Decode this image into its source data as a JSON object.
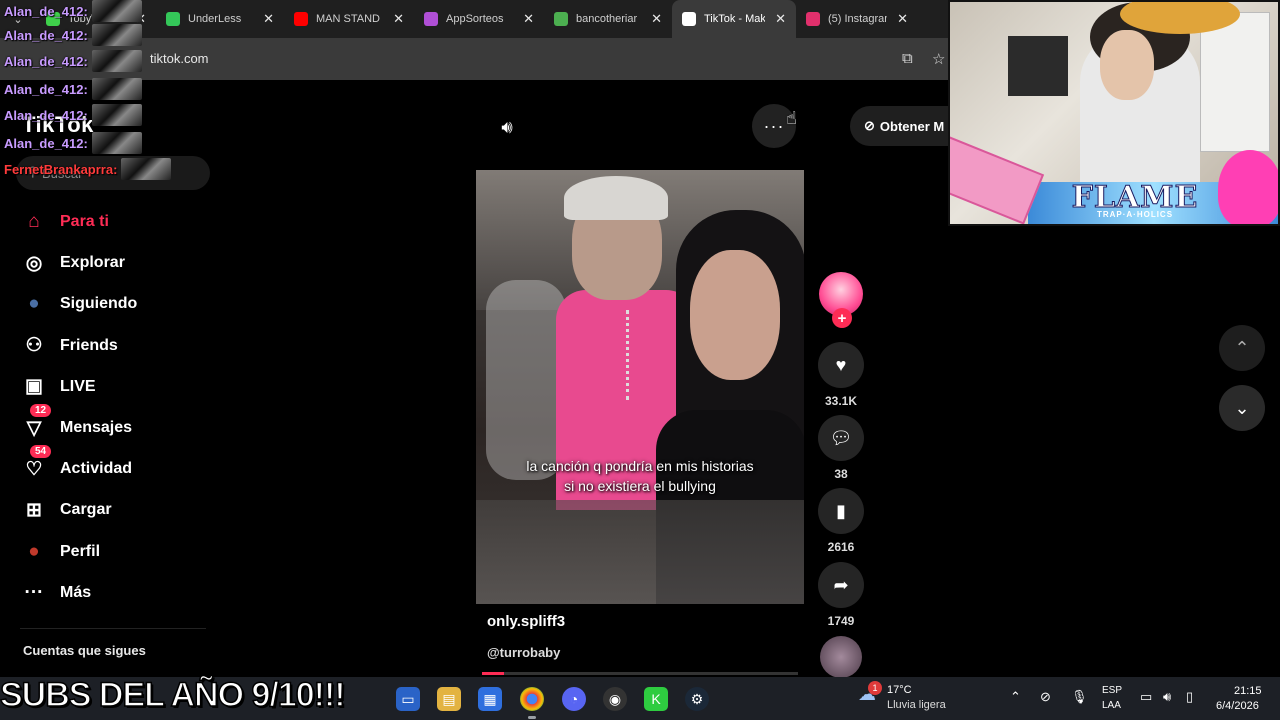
{
  "browser": {
    "tabs": [
      {
        "label": "TobyWuet",
        "color": "#3fd14b",
        "active": false
      },
      {
        "label": "UnderLess",
        "color": "#34c759",
        "active": false
      },
      {
        "label": "MAN STAND",
        "color": "#ff0000",
        "active": false
      },
      {
        "label": "AppSorteos",
        "color": "#b04fd6",
        "active": false
      },
      {
        "label": "bancotheriar",
        "color": "#4caf50",
        "active": false
      },
      {
        "label": "TikTok - Mak",
        "color": "#ffffff",
        "active": true
      },
      {
        "label": "(5) Instagran",
        "color": "#e1306c",
        "active": false
      }
    ],
    "tab_close": "✕",
    "url": "tiktok.com"
  },
  "chat": {
    "lines": [
      {
        "user": "Alan_de_412:"
      },
      {
        "user": "Alan_de_412:"
      },
      {
        "user": "Alan_de_412:"
      },
      {
        "user": "Alan_de_412:"
      },
      {
        "user": "Alan_de_412:"
      },
      {
        "user": "Alan_de_412:"
      },
      {
        "user": "FernetBrankaprra:"
      }
    ]
  },
  "sidebar": {
    "logo": "TikTok",
    "search_placeholder": "Buscar",
    "items": [
      {
        "label": "Para ti",
        "icon": "home-icon",
        "glyph": "⌂",
        "active": true,
        "badge": ""
      },
      {
        "label": "Explorar",
        "icon": "compass-icon",
        "glyph": "◎",
        "active": false,
        "badge": ""
      },
      {
        "label": "Siguiendo",
        "icon": "following-avatar-icon",
        "glyph": "●",
        "active": false,
        "badge": ""
      },
      {
        "label": "Friends",
        "icon": "friends-icon",
        "glyph": "⚇",
        "active": false,
        "badge": ""
      },
      {
        "label": "LIVE",
        "icon": "live-tv-icon",
        "glyph": "▣",
        "active": false,
        "badge": ""
      },
      {
        "label": "Mensajes",
        "icon": "messages-icon",
        "glyph": "▽",
        "active": false,
        "badge": "12"
      },
      {
        "label": "Actividad",
        "icon": "activity-icon",
        "glyph": "♡",
        "active": false,
        "badge": "54"
      },
      {
        "label": "Cargar",
        "icon": "upload-icon",
        "glyph": "⊞",
        "active": false,
        "badge": ""
      },
      {
        "label": "Perfil",
        "icon": "profile-avatar-icon",
        "glyph": "●",
        "active": false,
        "badge": ""
      },
      {
        "label": "Más",
        "icon": "more-dots-icon",
        "glyph": "···",
        "active": false,
        "badge": ""
      }
    ],
    "following_heading": "Cuentas que sigues"
  },
  "player": {
    "get_app_label": "Obtener M",
    "caption": "la canción q pondría en mis historias si no existiera el bullying",
    "author": "only.spliff3",
    "sound": "@turrobaby",
    "progress": 0.07,
    "likes": "33.1K",
    "comments": "38",
    "saves": "2616",
    "shares": "1749"
  },
  "webcam": {
    "banner": "FLAME",
    "banner_sub": "TRAP·A·HOLICS"
  },
  "taskbar": {
    "weather_temp": "17°C",
    "weather_desc": "Lluvia ligera",
    "weather_badge": "1",
    "lang_top": "ESP",
    "lang_bottom": "LAA",
    "time": "21:15",
    "date": "6/4/2026"
  },
  "overlay": {
    "banner": "SUBS DEL AÑO 9/10!!!"
  },
  "colors": {
    "accent": "#fe2c55",
    "background": "#000000"
  }
}
